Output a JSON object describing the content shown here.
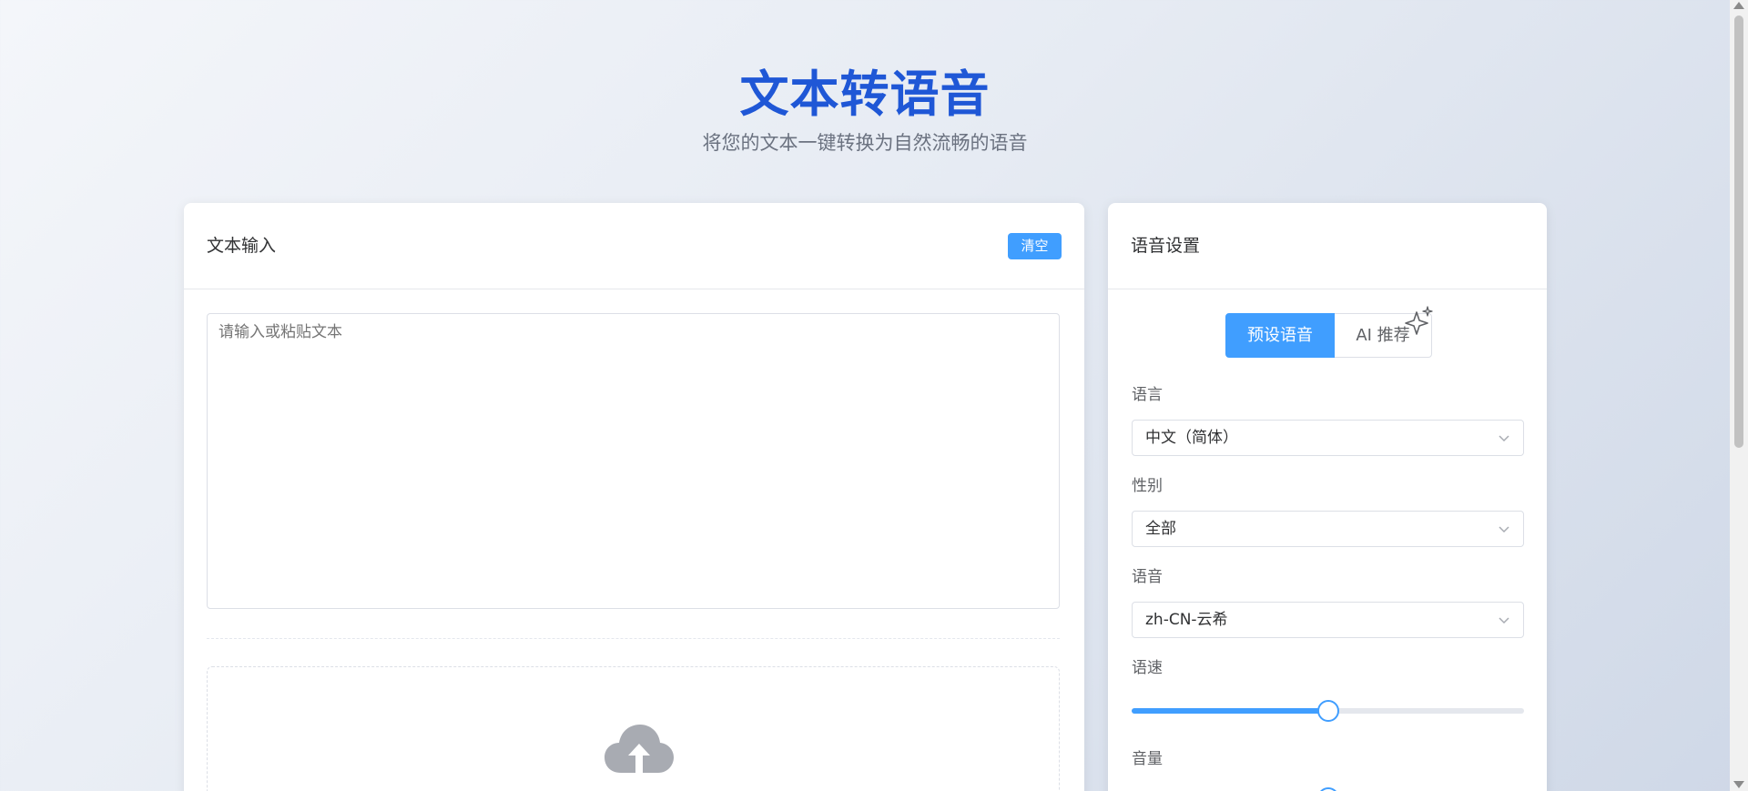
{
  "header": {
    "title": "文本转语音",
    "subtitle": "将您的文本一键转换为自然流畅的语音"
  },
  "text_panel": {
    "title": "文本输入",
    "clear_label": "清空",
    "textarea_value": "",
    "textarea_placeholder": "请输入或粘贴文本",
    "upload_icon": "cloud-upload-icon"
  },
  "voice_panel": {
    "title": "语音设置",
    "tabs": [
      {
        "label": "预设语音",
        "active": true
      },
      {
        "label": "AI 推荐",
        "active": false,
        "icon": "sparkle-icon"
      }
    ],
    "language": {
      "label": "语言",
      "value": "中文（简体）"
    },
    "gender": {
      "label": "性别",
      "value": "全部"
    },
    "voice": {
      "label": "语音",
      "value": "zh-CN-云希"
    },
    "rate": {
      "label": "语速",
      "value_fraction": 0.5
    },
    "volume": {
      "label": "音量"
    }
  },
  "colors": {
    "accent": "#409eff",
    "title": "#1f57d6"
  }
}
